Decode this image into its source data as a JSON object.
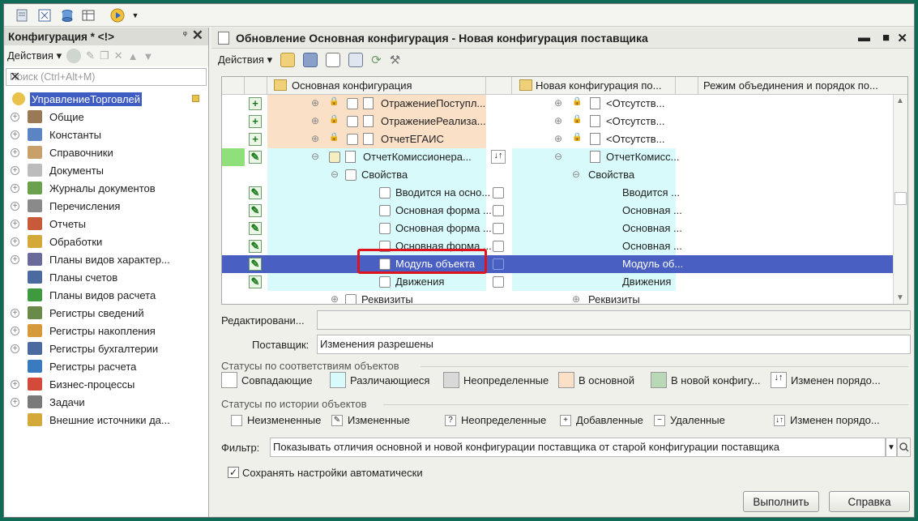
{
  "left_panel": {
    "title": "Конфигурация * <!>",
    "actions_label": "Действия ▾",
    "search_placeholder": "Поиск (Ctrl+Alt+M)",
    "tree": [
      {
        "label": "УправлениеТорговлей",
        "selected": true,
        "icon_color": "#e8c24a",
        "expandable": false
      },
      {
        "label": "Общие",
        "icon_color": "#9a7a56",
        "expandable": true
      },
      {
        "label": "Константы",
        "icon_color": "#5b84c4",
        "expandable": true
      },
      {
        "label": "Справочники",
        "icon_color": "#c9a06a",
        "expandable": true
      },
      {
        "label": "Документы",
        "icon_color": "#bcbcbc",
        "expandable": true
      },
      {
        "label": "Журналы документов",
        "icon_color": "#6aa04e",
        "expandable": true
      },
      {
        "label": "Перечисления",
        "icon_color": "#8a8a8a",
        "expandable": true
      },
      {
        "label": "Отчеты",
        "icon_color": "#c85a3a",
        "expandable": true
      },
      {
        "label": "Обработки",
        "icon_color": "#d4a93a",
        "expandable": true
      },
      {
        "label": "Планы видов характер...",
        "icon_color": "#6a6a9a",
        "expandable": true
      },
      {
        "label": "Планы счетов",
        "icon_color": "#4a6aa0",
        "expandable": false
      },
      {
        "label": "Планы видов расчета",
        "icon_color": "#3f9a3f",
        "expandable": false
      },
      {
        "label": "Регистры сведений",
        "icon_color": "#6a8a4a",
        "expandable": true
      },
      {
        "label": "Регистры накопления",
        "icon_color": "#d69a3a",
        "expandable": true
      },
      {
        "label": "Регистры бухгалтерии",
        "icon_color": "#4a6aa0",
        "expandable": true
      },
      {
        "label": "Регистры расчета",
        "icon_color": "#3a7abf",
        "expandable": false
      },
      {
        "label": "Бизнес-процессы",
        "icon_color": "#d44a3a",
        "expandable": true
      },
      {
        "label": "Задачи",
        "icon_color": "#7a7a7a",
        "expandable": true
      },
      {
        "label": "Внешние источники да...",
        "icon_color": "#d4a93a",
        "expandable": false
      }
    ]
  },
  "window": {
    "title": "Обновление Основная конфигурация - Новая конфигурация поставщика",
    "actions_label": "Действия ▾",
    "columns": {
      "main": "Основная конфигурация",
      "vendor": "Новая конфигурация по...",
      "mode": "Режим объединения и порядок по..."
    },
    "rows": [
      {
        "status": "+",
        "left_text": "ОтражениеПоступл...",
        "right_text": "<Отсутств...",
        "left_bg": "#fbe0c8",
        "right_bg": "#ffffff",
        "sel": false,
        "depth": 0
      },
      {
        "status": "+",
        "left_text": "ОтражениеРеализа...",
        "right_text": "<Отсутств...",
        "left_bg": "#fbe0c8",
        "right_bg": "#ffffff",
        "sel": false,
        "depth": 0
      },
      {
        "status": "+",
        "left_text": "ОтчетЕГАИС",
        "right_text": "<Отсутств...",
        "left_bg": "#fbe0c8",
        "right_bg": "#ffffff",
        "sel": false,
        "depth": 0
      },
      {
        "status": "~",
        "left_text": "ОтчетКомиссионера...",
        "right_text": "ОтчетКомисс...",
        "left_bg": "#d8fafa",
        "right_bg": "#d8fafa",
        "sel": false,
        "depth": 0
      },
      {
        "status": "",
        "left_text": "Свойства",
        "right_text": "Свойства",
        "left_bg": "#d8fafa",
        "right_bg": "#d8fafa",
        "sel": false,
        "depth": 1
      },
      {
        "status": "~",
        "left_text": "Вводится на осно...",
        "right_text": "Вводится ...",
        "left_bg": "#d8fafa",
        "right_bg": "#d8fafa",
        "sel": false,
        "depth": 2
      },
      {
        "status": "~",
        "left_text": "Основная форма ...",
        "right_text": "Основная ...",
        "left_bg": "#d8fafa",
        "right_bg": "#d8fafa",
        "sel": false,
        "depth": 2
      },
      {
        "status": "~",
        "left_text": "Основная форма ...",
        "right_text": "Основная ...",
        "left_bg": "#d8fafa",
        "right_bg": "#d8fafa",
        "sel": false,
        "depth": 2
      },
      {
        "status": "~",
        "left_text": "Основная форма ...",
        "right_text": "Основная ...",
        "left_bg": "#d8fafa",
        "right_bg": "#d8fafa",
        "sel": false,
        "depth": 2
      },
      {
        "status": "~",
        "left_text": "Модуль объекта",
        "right_text": "Модуль об...",
        "left_bg": "#4a5fc2",
        "right_bg": "#4a5fc2",
        "sel": true,
        "depth": 2
      },
      {
        "status": "~",
        "left_text": "Движения",
        "right_text": "Движения",
        "left_bg": "#d8fafa",
        "right_bg": "#d8fafa",
        "sel": false,
        "depth": 2
      },
      {
        "status": "",
        "left_text": "Реквизиты",
        "right_text": "Реквизиты",
        "left_bg": "#ffffff",
        "right_bg": "#ffffff",
        "sel": false,
        "depth": 1
      }
    ],
    "editing_label": "Редактировани...",
    "editing_value": "",
    "supplier_label": "Поставщик:",
    "supplier_value": "Изменения разрешены",
    "status_match_title": "Статусы по соответствиям объектов",
    "match_legend": [
      {
        "label": "Совпадающие",
        "color": "#ffffff"
      },
      {
        "label": "Различающиеся",
        "color": "#d8fafa"
      },
      {
        "label": "Неопределенные",
        "color": "#d9d9d9"
      },
      {
        "label": "В основной",
        "color": "#fbe0c8"
      },
      {
        "label": "В новой конфигу...",
        "color": "#b9d9b6"
      },
      {
        "label": "Изменен порядо...",
        "color": "#ffffff"
      }
    ],
    "status_history_title": "Статусы по истории объектов",
    "history_legend": [
      {
        "label": "Неизмененные",
        "glyph": ""
      },
      {
        "label": "Измененные",
        "glyph": "✎"
      },
      {
        "label": "Неопределенные",
        "glyph": "?"
      },
      {
        "label": "Добавленные",
        "glyph": "+"
      },
      {
        "label": "Удаленные",
        "glyph": "−"
      },
      {
        "label": "Изменен порядо...",
        "glyph": "↓↑"
      }
    ],
    "filter_label": "Фильтр:",
    "filter_value": "Показывать отличия основной и новой конфигурации поставщика от старой конфигурации поставщика",
    "save_settings_label": "Сохранять настройки автоматически",
    "execute_button": "Выполнить",
    "help_button": "Справка"
  }
}
